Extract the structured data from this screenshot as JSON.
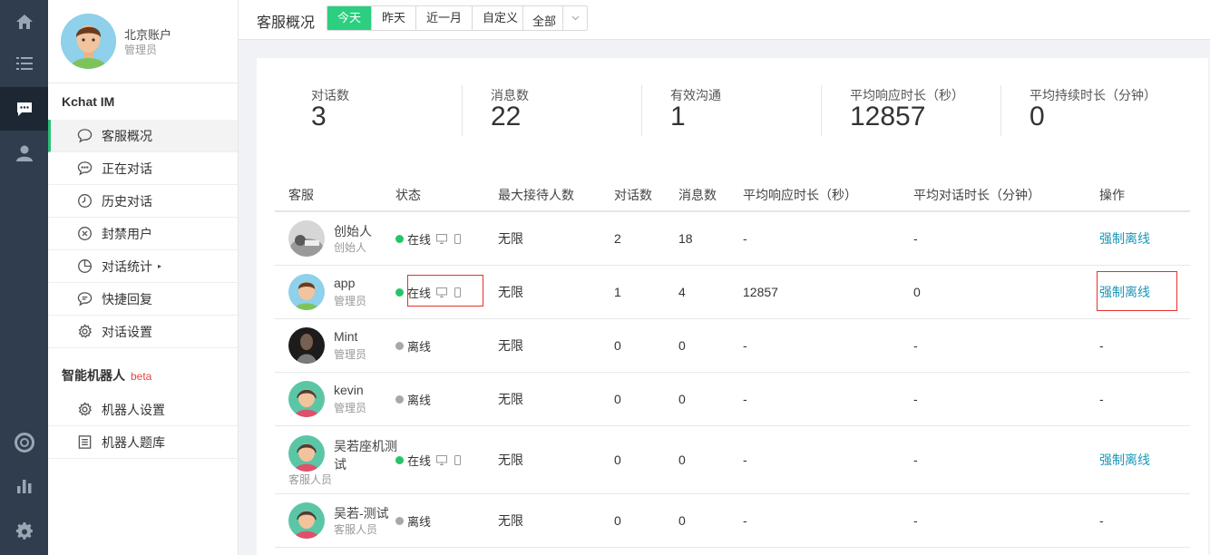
{
  "account": {
    "name": "北京账户",
    "role": "管理员"
  },
  "sidebar": {
    "group1_title": "Kchat IM",
    "group1_items": [
      {
        "label": "客服概况",
        "icon": "chat-bubble-icon"
      },
      {
        "label": "正在对话",
        "icon": "chat-active-icon"
      },
      {
        "label": "历史对话",
        "icon": "clock-icon"
      },
      {
        "label": "封禁用户",
        "icon": "ban-icon"
      },
      {
        "label": "对话统计",
        "icon": "pie-chart-icon",
        "has_submenu_arrow": true,
        "arrow": "▸"
      },
      {
        "label": "快捷回复",
        "icon": "quick-reply-icon"
      },
      {
        "label": "对话设置",
        "icon": "gear-icon"
      }
    ],
    "group2_title": "智能机器人",
    "group2_badge": "beta",
    "group2_items": [
      {
        "label": "机器人设置",
        "icon": "gear-icon"
      },
      {
        "label": "机器人题库",
        "icon": "document-list-icon"
      }
    ]
  },
  "topbar": {
    "title": "客服概况",
    "range_options": [
      "今天",
      "昨天",
      "近一月",
      "自定义"
    ],
    "range_selected": "今天",
    "filter_value": "全部"
  },
  "stats": [
    {
      "label": "对话数",
      "value": "3"
    },
    {
      "label": "消息数",
      "value": "22"
    },
    {
      "label": "有效沟通",
      "value": "1"
    },
    {
      "label": "平均响应时长（秒）",
      "value": "12857"
    },
    {
      "label": "平均持续时长（分钟）",
      "value": "0"
    }
  ],
  "table": {
    "headers": [
      "客服",
      "状态",
      "最大接待人数",
      "对话数",
      "消息数",
      "平均响应时长（秒）",
      "平均对话时长（分钟）",
      "操作"
    ],
    "rows": [
      {
        "name": "创始人",
        "role": "创始人",
        "status": "在线",
        "online": true,
        "max": "无限",
        "conversations": "2",
        "messages": "18",
        "avg_response": "-",
        "avg_duration": "-",
        "action": "强制离线"
      },
      {
        "name": "app",
        "role": "管理员",
        "status": "在线",
        "online": true,
        "max": "无限",
        "conversations": "1",
        "messages": "4",
        "avg_response": "12857",
        "avg_duration": "0",
        "action": "强制离线"
      },
      {
        "name": "Mint",
        "role": "管理员",
        "status": "离线",
        "online": false,
        "max": "无限",
        "conversations": "0",
        "messages": "0",
        "avg_response": "-",
        "avg_duration": "-",
        "action": "-"
      },
      {
        "name": "kevin",
        "role": "管理员",
        "status": "离线",
        "online": false,
        "max": "无限",
        "conversations": "0",
        "messages": "0",
        "avg_response": "-",
        "avg_duration": "-",
        "action": "-"
      },
      {
        "name": "吴若座机测试",
        "role": "客服人员",
        "status": "在线",
        "online": true,
        "max": "无限",
        "conversations": "0",
        "messages": "0",
        "avg_response": "-",
        "avg_duration": "-",
        "action": "强制离线"
      },
      {
        "name": "吴若-测试",
        "role": "客服人员",
        "status": "离线",
        "online": false,
        "max": "无限",
        "conversations": "0",
        "messages": "0",
        "avg_response": "-",
        "avg_duration": "-",
        "action": "-"
      }
    ]
  },
  "colors": {
    "accent": "#2bcf7f",
    "link": "#1a97b8",
    "rail": "#2f3d4e",
    "highlight": "#e5312b"
  }
}
